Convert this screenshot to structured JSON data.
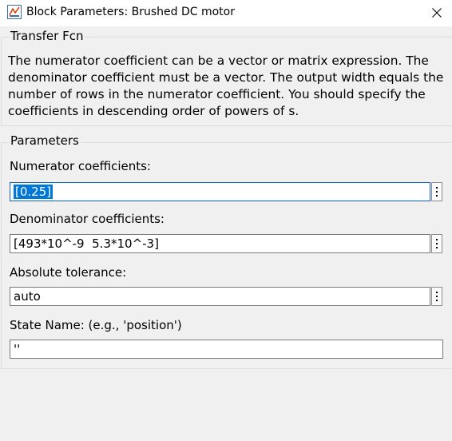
{
  "window": {
    "title": "Block Parameters: Brushed DC motor",
    "close_icon": "close-icon",
    "app_icon": "simulink-block-icon"
  },
  "block": {
    "type": "Transfer Fcn",
    "description": "The numerator coefficient can be a vector or matrix expression. The denominator coefficient must be a vector. The output width equals the number of rows in the numerator coefficient. You should specify the coefficients in descending order of powers of s."
  },
  "parameters": {
    "title": "Parameters",
    "numerator_label": "Numerator coefficients:",
    "numerator_value": "[0.25]",
    "denominator_label": "Denominator coefficients:",
    "denominator_value": "[493*10^-9  5.3*10^-3]",
    "tolerance_label": "Absolute tolerance:",
    "tolerance_value": "auto",
    "state_label": "State Name: (e.g., 'position')",
    "state_value": "''"
  },
  "colors": {
    "background": "#f0f0f0",
    "selection": "#0078d7",
    "focus_border": "#0a64c8"
  }
}
